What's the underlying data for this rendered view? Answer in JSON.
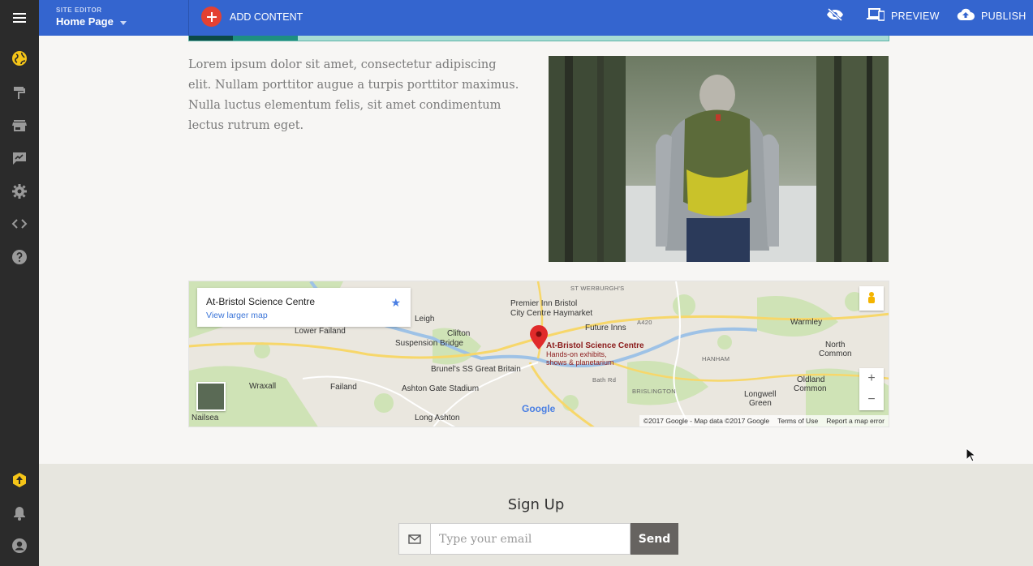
{
  "topbar": {
    "site_editor_label": "SITE EDITOR",
    "page_name": "Home Page",
    "add_content": "ADD CONTENT",
    "preview": "PREVIEW",
    "publish": "PUBLISH"
  },
  "rail": {
    "items": [
      "globe-icon",
      "brush-icon",
      "store-icon",
      "reviews-icon",
      "settings-icon",
      "code-icon",
      "help-icon"
    ],
    "bottom": [
      "upgrade-icon",
      "bell-icon",
      "account-icon"
    ],
    "accent": "#f5c518"
  },
  "content": {
    "lorem": "Lorem ipsum dolor sit amet, consectetur adipiscing elit. Nullam porttitor augue a turpis porttitor maximus. Nulla luctus elementum felis, sit amet condimentum lectus rutrum eget."
  },
  "map": {
    "place_name": "At-Bristol Science Centre",
    "larger_map_link": "View larger map",
    "pin_label": "At-Bristol Science Centre",
    "pin_sub1": "Hands-on exhibits,",
    "pin_sub2": "shows & planetarium",
    "labels": {
      "premier_inn_1": "Premier Inn Bristol",
      "premier_inn_2": "City Centre Haymarket",
      "future_inns": "Future Inns",
      "clifton": "Clifton",
      "suspension_bridge": "Suspension Bridge",
      "brunels": "Brunel's SS Great Britain",
      "ashton_gate": "Ashton Gate Stadium",
      "lower_failand": "Lower Failand",
      "wraxall": "Wraxall",
      "failand": "Failand",
      "nailsea": "Nailsea",
      "long_ashton": "Long Ashton",
      "leigh": "Leigh",
      "warmley": "Warmley",
      "north_common_1": "North",
      "north_common_2": "Common",
      "oldland_1": "Oldland",
      "oldland_2": "Common",
      "longwell_1": "Longwell",
      "longwell_2": "Green",
      "st_werburghs": "ST WERBURGH'S",
      "hanham": "HANHAM",
      "brislington": "BRISLINGTON",
      "bath_rd": "Bath Rd",
      "a420": "A420",
      "google": "Google"
    },
    "attribution": "©2017 Google - Map data ©2017 Google",
    "terms": "Terms of Use",
    "report": "Report a map error",
    "zoom_in": "+",
    "zoom_out": "−"
  },
  "signup": {
    "title": "Sign Up",
    "placeholder": "Type your email",
    "send": "Send"
  }
}
